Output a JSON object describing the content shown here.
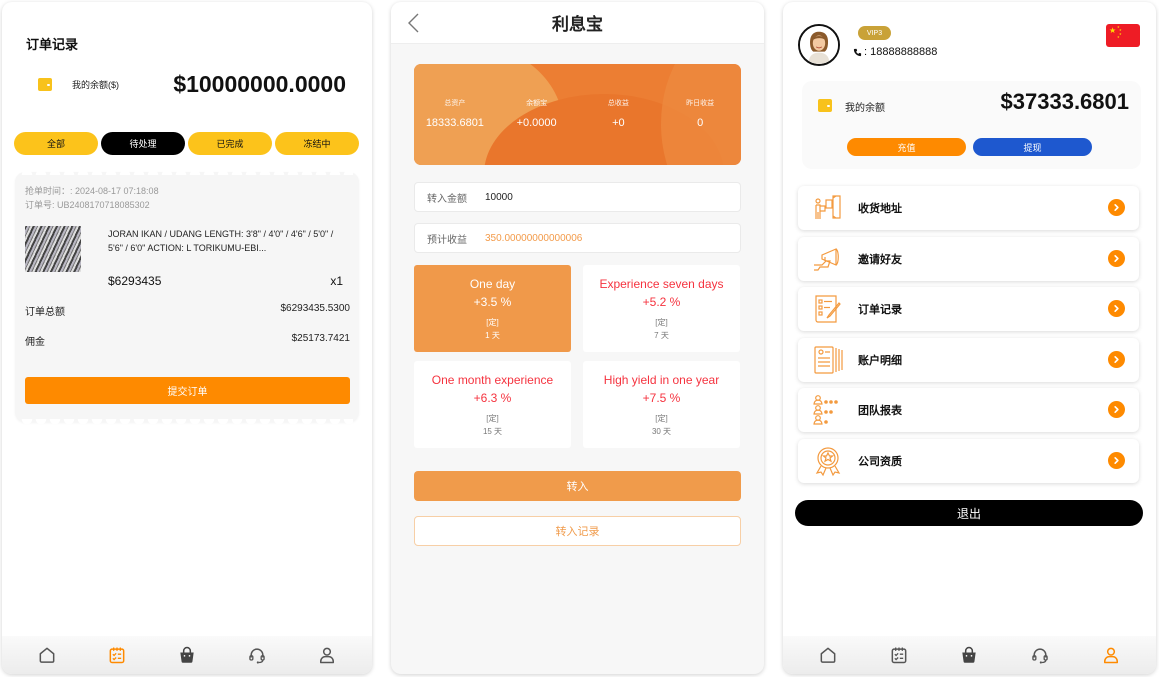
{
  "colors": {
    "yellow": "#fcc31b",
    "orange": "#fe8a00",
    "soft_orange": "#f09b4b",
    "red_text": "#f5333f",
    "blue": "#1e58cf",
    "vip_gold": "#c9a238"
  },
  "tabbar": {
    "items": [
      {
        "name": "home",
        "icon": "home-icon"
      },
      {
        "name": "orders",
        "icon": "calendar-checklist-icon"
      },
      {
        "name": "shop",
        "icon": "shopping-bag-icon"
      },
      {
        "name": "service",
        "icon": "headset-icon"
      },
      {
        "name": "profile",
        "icon": "user-icon"
      }
    ]
  },
  "orders_screen": {
    "title": "订单记录",
    "balance_label": "我的余额($)",
    "balance_value": "$10000000.0000",
    "filters": [
      {
        "label": "全部",
        "active": false
      },
      {
        "label": "待处理",
        "active": true
      },
      {
        "label": "已完成",
        "active": false
      },
      {
        "label": "冻结中",
        "active": false
      }
    ],
    "order": {
      "grab_time": "抢单时间：: 2024-08-17 07:18:08",
      "order_no": "订单号: UB2408170718085302",
      "product_name": "JORAN IKAN / UDANG LENGTH: 3'8\" / 4'0\" / 4'6\" / 5'0\" / 5'6\" / 6'0\" ACTION: L TORIKUMU-EBI...",
      "price": "$6293435",
      "quantity": "x1",
      "total_label": "订单总额",
      "total_value": "$6293435.5300",
      "commission_label": "佣金",
      "commission_value": "$25173.7421",
      "submit_label": "提交订单"
    },
    "active_tab": "orders"
  },
  "interest_screen": {
    "title": "利息宝",
    "stats": [
      {
        "label": "总资产",
        "value": "18333.6801"
      },
      {
        "label": "余额宝",
        "value": "+0.0000"
      },
      {
        "label": "总收益",
        "value": "+0"
      },
      {
        "label": "昨日收益",
        "value": "0"
      }
    ],
    "amount_label": "转入金额",
    "amount_value": "10000",
    "expected_label": "预计收益",
    "expected_value": "350.00000000000006",
    "plans": [
      {
        "name": "One day",
        "rate": "+3.5 %",
        "type": "[定]",
        "days": "1 天",
        "active": true
      },
      {
        "name": "Experience seven days",
        "rate": "+5.2 %",
        "type": "[定]",
        "days": "7 天",
        "active": false
      },
      {
        "name": "One month experience",
        "rate": "+6.3 %",
        "type": "[定]",
        "days": "15 天",
        "active": false
      },
      {
        "name": "High yield in one year",
        "rate": "+7.5 %",
        "type": "[定]",
        "days": "30 天",
        "active": false
      }
    ],
    "transfer_label": "转入",
    "record_label": "转入记录"
  },
  "profile_screen": {
    "vip": "VIP3",
    "phone": ": 18888888888",
    "balance_label": "我的余额",
    "balance_value": "$37333.6801",
    "recharge_label": "充值",
    "withdraw_label": "提现",
    "menu": [
      {
        "label": "收货地址",
        "icon": "delivery-address-icon"
      },
      {
        "label": "邀请好友",
        "icon": "invite-megaphone-icon"
      },
      {
        "label": "订单记录",
        "icon": "order-record-icon"
      },
      {
        "label": "账户明细",
        "icon": "account-details-icon"
      },
      {
        "label": "团队报表",
        "icon": "team-report-icon"
      },
      {
        "label": "公司资质",
        "icon": "company-certificate-icon"
      }
    ],
    "logout_label": "退出",
    "active_tab": "profile"
  }
}
